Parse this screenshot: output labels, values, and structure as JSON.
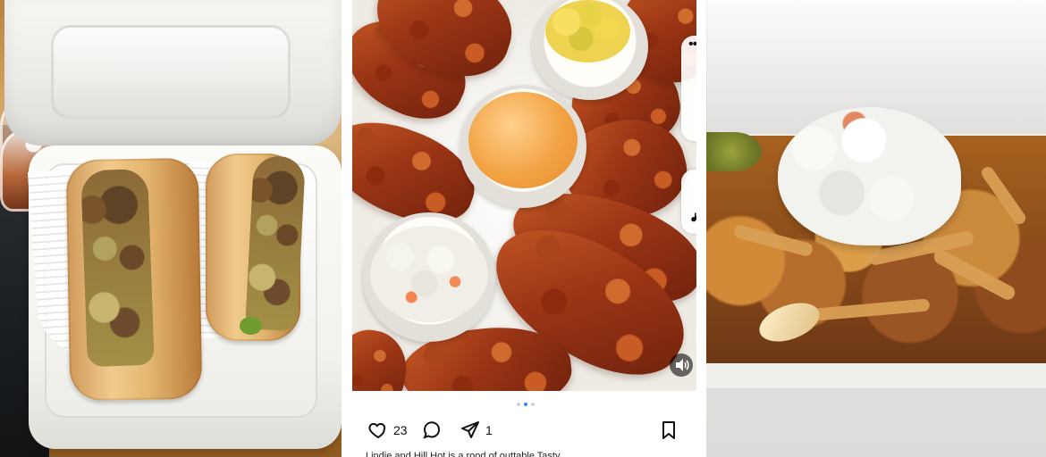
{
  "instagram": {
    "likes": "23",
    "shares": "1",
    "caption": "Lindie and Hill Hot is a rood of outtable Tasty"
  },
  "icons": {
    "like": "heart-icon",
    "comment": "comment-icon",
    "share": "send-icon",
    "save": "bookmark-icon",
    "more": "more-dots-icon",
    "audio": "music-note-icon",
    "volume": "volume-icon"
  },
  "carousel": {
    "current_index": 2,
    "total": 3
  }
}
